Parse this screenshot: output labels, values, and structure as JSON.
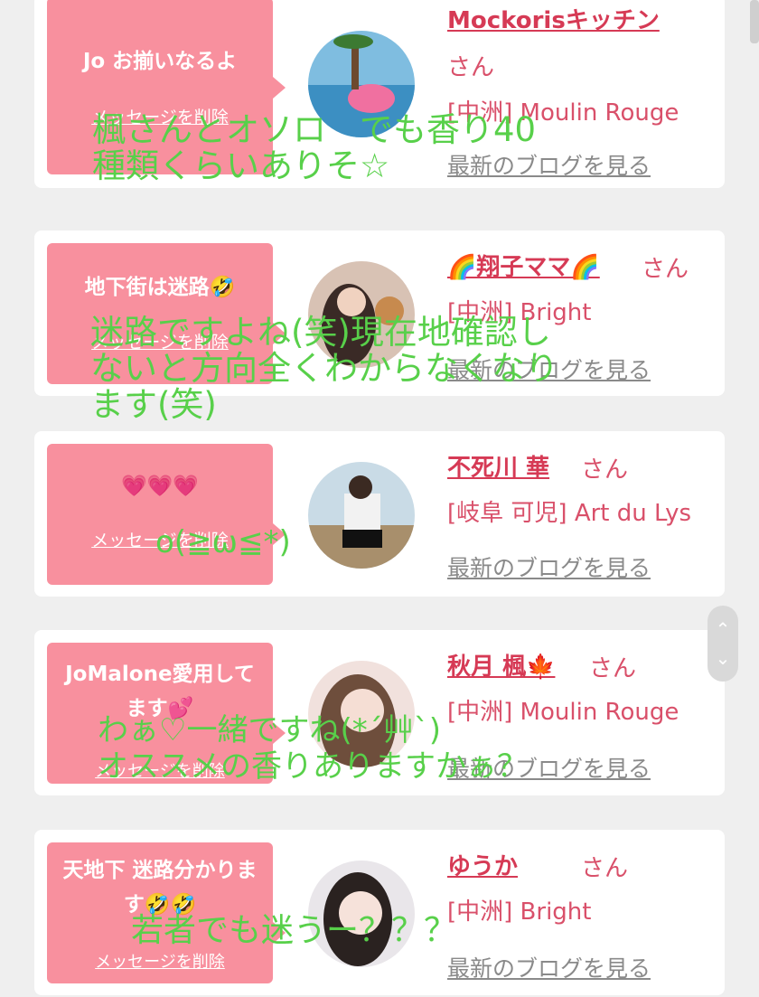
{
  "cards": [
    {
      "message": "Jo お揃いなるよ",
      "delete_label": "メッセージを削除",
      "name": "Mockorisキッチン",
      "honorific": "さん",
      "shop": "[中洲] Moulin Rouge",
      "blog_link": "最新のブログを見る"
    },
    {
      "message": "地下街は迷路🤣",
      "delete_label": "メッセージを削除",
      "name": "🌈翔子ママ🌈",
      "honorific": "さん",
      "shop": "[中洲] Bright",
      "blog_link": "最新のブログを見る"
    },
    {
      "message": "💗💗💗",
      "delete_label": "メッセージを削除",
      "name": "不死川 華",
      "honorific": "さん",
      "shop": "[岐阜 可児] Art du Lys",
      "blog_link": "最新のブログを見る"
    },
    {
      "message": "JoMalone愛用してます💕",
      "delete_label": "メッセージを削除",
      "name": "秋月 楓🍁",
      "honorific": "さん",
      "shop": "[中洲] Moulin Rouge",
      "blog_link": "最新のブログを見る"
    },
    {
      "message": "天地下 迷路分かります🤣🤣",
      "delete_label": "メッセージを削除",
      "name": "ゆうか",
      "honorific": "さん",
      "shop": "[中洲] Bright",
      "blog_link": "最新のブログを見る"
    }
  ],
  "overlays": [
    "楓さんとオソロ　でも香り40\n種類くらいありそ☆",
    "迷路ですよね(笑)現在地確認し\nないと方向全くわからなくなり\nます(笑)",
    "o(≧ω≦*)",
    "わぁ♡一緒ですね(*´艸`)\nオススメの香りありますかぁ？",
    "若者でも迷うー？？？"
  ],
  "colors": {
    "bubble": "#f8909e",
    "name": "#d63a55",
    "overlay_text": "#58d04a",
    "overlay_pink": "#ff5ad2",
    "background": "#efefef"
  },
  "icons": {
    "scroll_up": "chevron-up-icon",
    "scroll_down": "chevron-down-icon"
  }
}
